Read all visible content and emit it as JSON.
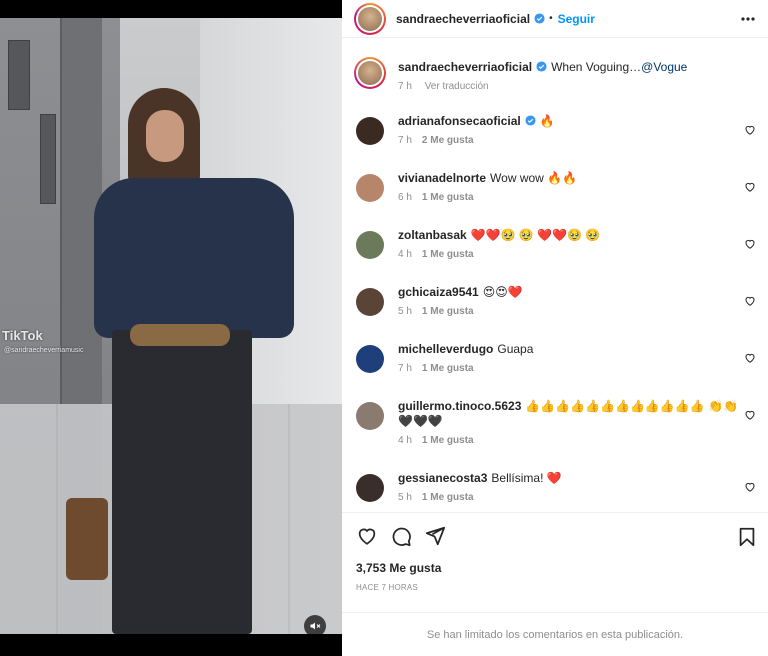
{
  "app": {
    "accent": "#0095f6",
    "verified_color": "#3897f0"
  },
  "media": {
    "watermark": "TikTok",
    "watermark_handle": "@sandraecheverriamusic",
    "mute_icon": "speaker-muted-icon"
  },
  "header": {
    "username": "sandraecheverriaoficial",
    "separator": "•",
    "follow_label": "Seguir",
    "more_icon": "more-horizontal-icon"
  },
  "caption": {
    "username": "sandraecheverriaoficial",
    "text": "When Voguing…",
    "mention": "@Vogue",
    "time": "7 h",
    "translate_label": "Ver traducción"
  },
  "comments": [
    {
      "username": "adrianafonsecaoficial",
      "verified": true,
      "text": "🔥",
      "time": "7 h",
      "likes": "2 Me gusta",
      "avatar_color": "#3a2a22"
    },
    {
      "username": "vivianadelnorte",
      "verified": false,
      "text": "Wow wow 🔥🔥",
      "time": "6 h",
      "likes": "1 Me gusta",
      "avatar_color": "#b7866a"
    },
    {
      "username": "zoltanbasak",
      "verified": false,
      "text": "❤️❤️🥹 🥹 ❤️❤️🥹 🥹",
      "time": "4 h",
      "likes": "1 Me gusta",
      "avatar_color": "#6b7a5a"
    },
    {
      "username": "gchicaiza9541",
      "verified": false,
      "text": "😍😍❤️",
      "time": "5 h",
      "likes": "1 Me gusta",
      "avatar_color": "#5a4438"
    },
    {
      "username": "michelleverdugo",
      "verified": false,
      "text": "Guapa",
      "time": "7 h",
      "likes": "1 Me gusta",
      "avatar_color": "#1f3f7a"
    },
    {
      "username": "guillermo.tinoco.5623",
      "verified": false,
      "text": "👍👍👍👍👍👍👍👍👍👍👍👍 👏👏🖤🖤🖤",
      "time": "4 h",
      "likes": "1 Me gusta",
      "avatar_color": "#8a7a70"
    },
    {
      "username": "gessianecosta3",
      "verified": false,
      "text": "Bellísima! ❤️",
      "time": "5 h",
      "likes": "1 Me gusta",
      "avatar_color": "#3a2e2a"
    }
  ],
  "actions": {
    "like_icon": "heart-icon",
    "comment_icon": "comment-icon",
    "share_icon": "share-icon",
    "save_icon": "bookmark-icon",
    "likes_count": "3,753 Me gusta",
    "timestamp": "HACE 7 HORAS"
  },
  "footer": {
    "note": "Se han limitado los comentarios en esta publicación."
  }
}
